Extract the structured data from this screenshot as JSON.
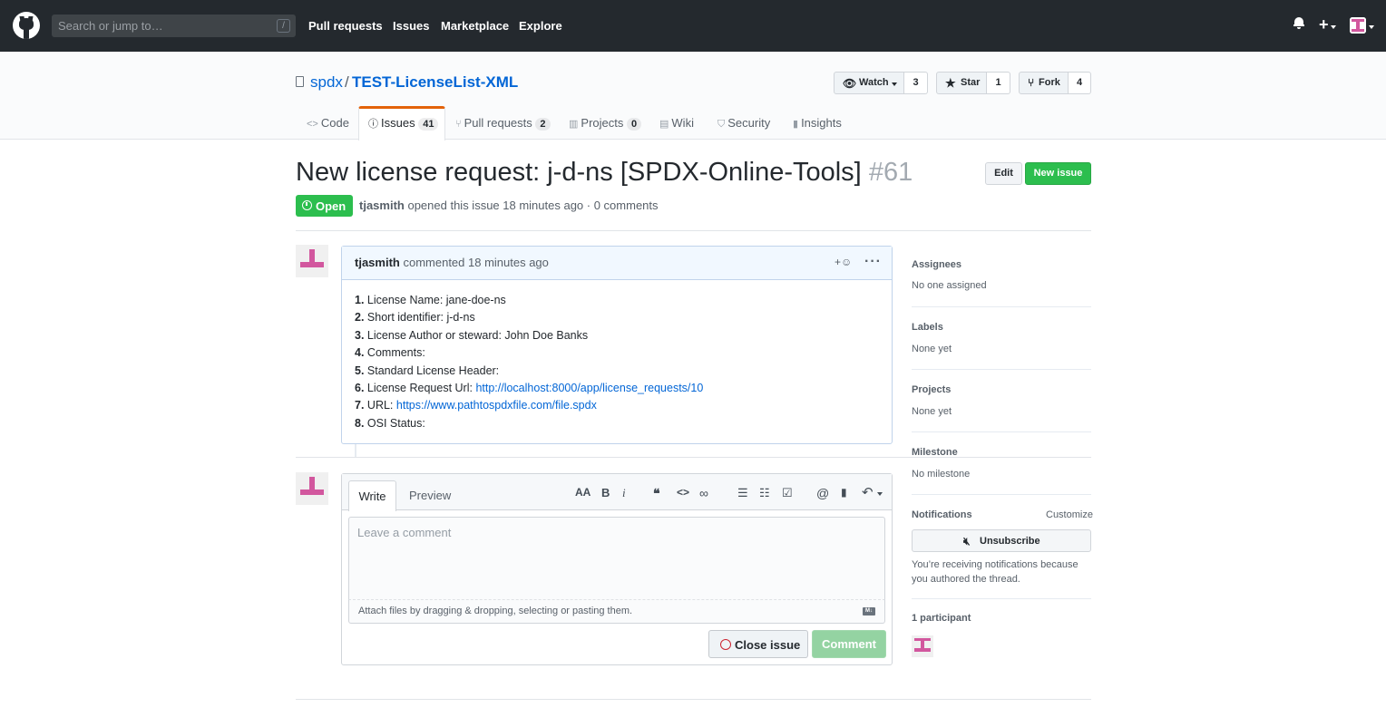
{
  "header": {
    "search_placeholder": "Search or jump to…",
    "search_shortcut": "/",
    "nav": [
      "Pull requests",
      "Issues",
      "Marketplace",
      "Explore"
    ],
    "plus_label": "+"
  },
  "repo": {
    "owner": "spdx",
    "separator": "/",
    "name": "TEST-LicenseList-XML",
    "watch_label": "Watch",
    "watch_count": "3",
    "star_label": "Star",
    "star_count": "1",
    "fork_label": "Fork",
    "fork_count": "4"
  },
  "reponav": {
    "code": "Code",
    "issues": "Issues",
    "issues_count": "41",
    "pulls": "Pull requests",
    "pulls_count": "2",
    "projects": "Projects",
    "projects_count": "0",
    "wiki": "Wiki",
    "security": "Security",
    "insights": "Insights"
  },
  "issue": {
    "title": "New license request: j-d-ns [SPDX-Online-Tools]",
    "number": "#61",
    "edit_label": "Edit",
    "new_issue_label": "New issue",
    "state": "Open",
    "author": "tjasmith",
    "meta_text": "opened this issue 18 minutes ago · 0 comments"
  },
  "comment": {
    "author": "tjasmith",
    "time_text": "commented 18 minutes ago",
    "reaction_label": "+☺",
    "more_label": "···",
    "items": [
      {
        "num": "1.",
        "label": "License Name: jane-doe-ns",
        "link": ""
      },
      {
        "num": "2.",
        "label": "Short identifier: j-d-ns",
        "link": ""
      },
      {
        "num": "3.",
        "label": "License Author or steward: John Doe Banks",
        "link": ""
      },
      {
        "num": "4.",
        "label": "Comments:",
        "link": ""
      },
      {
        "num": "5.",
        "label": "Standard License Header:",
        "link": ""
      },
      {
        "num": "6.",
        "label": "License Request Url:",
        "link": "http://localhost:8000/app/license_requests/10"
      },
      {
        "num": "7.",
        "label": "URL:",
        "link": "https://www.pathtospdxfile.com/file.spdx"
      },
      {
        "num": "8.",
        "label": "OSI Status:",
        "link": ""
      }
    ]
  },
  "new_comment": {
    "tab_write": "Write",
    "tab_preview": "Preview",
    "toolbar": {
      "header": "AA",
      "bold": "B",
      "italic": "i",
      "quote": "❝",
      "code": "<>",
      "link": "∞",
      "bullet_list": "☰",
      "numbered_list": "☷",
      "task_list": "☑",
      "mention": "@",
      "reference": "▮",
      "reply": "↶"
    },
    "placeholder": "Leave a comment",
    "attach_text": "Attach files by dragging & dropping, selecting or pasting them.",
    "markdown_badge": "M↓",
    "close_issue_label": "Close issue",
    "comment_label": "Comment"
  },
  "sidebar": {
    "assignees_h": "Assignees",
    "assignees_v": "No one assigned",
    "labels_h": "Labels",
    "labels_v": "None yet",
    "projects_h": "Projects",
    "projects_v": "None yet",
    "milestone_h": "Milestone",
    "milestone_v": "No milestone",
    "notifications_h": "Notifications",
    "customize": "Customize",
    "unsubscribe": "Unsubscribe",
    "notif_text": "You’re receiving notifications because you authored the thread.",
    "participants_h": "1 participant"
  },
  "colors": {
    "header_bg": "#24292e",
    "link": "#0366d6",
    "green": "#2cbe4e",
    "identicon": "#d2579e",
    "issues_tab_accent": "#e36209"
  }
}
